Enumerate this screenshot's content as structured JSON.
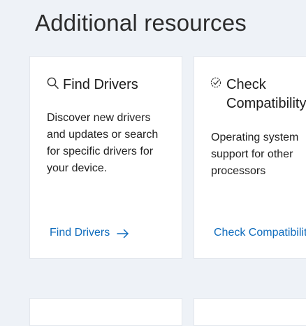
{
  "section": {
    "title": "Additional resources"
  },
  "cards": [
    {
      "title": "Find Drivers",
      "icon": "search-icon",
      "description": "Discover new drivers and updates or search for specific drivers for your device.",
      "link_label": "Find Drivers"
    },
    {
      "title": "Check\nCompatibility",
      "icon": "check-circle-icon",
      "description": "Operating system support for other processors",
      "link_label": "Check Compatibility"
    }
  ],
  "colors": {
    "background": "#eef2f7",
    "card": "#ffffff",
    "link": "#0f6cbd",
    "text": "#1b1b1b"
  }
}
